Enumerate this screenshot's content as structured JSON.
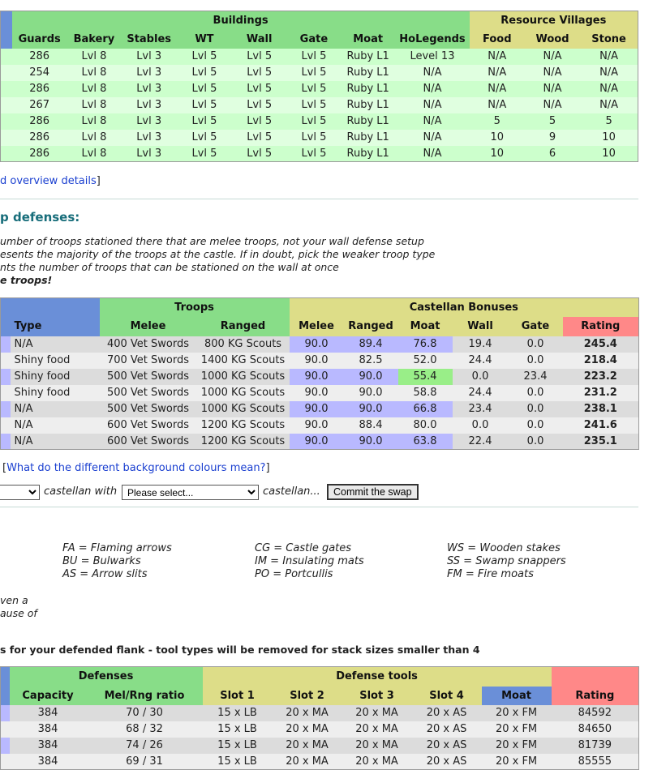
{
  "buildings_table": {
    "group_headers": {
      "buildings": "Buildings",
      "resource_villages": "Resource Villages"
    },
    "columns": [
      "Guards",
      "Bakery",
      "Stables",
      "WT",
      "Wall",
      "Gate",
      "Moat",
      "HoLegends",
      "Food",
      "Wood",
      "Stone"
    ],
    "rows": [
      [
        "286",
        "Lvl 8",
        "Lvl 3",
        "Lvl 5",
        "Lvl 5",
        "Lvl 5",
        "Ruby L1",
        "Level 13",
        "N/A",
        "N/A",
        "N/A"
      ],
      [
        "254",
        "Lvl 8",
        "Lvl 3",
        "Lvl 5",
        "Lvl 5",
        "Lvl 5",
        "Ruby L1",
        "N/A",
        "N/A",
        "N/A",
        "N/A"
      ],
      [
        "286",
        "Lvl 8",
        "Lvl 3",
        "Lvl 5",
        "Lvl 5",
        "Lvl 5",
        "Ruby L1",
        "N/A",
        "N/A",
        "N/A",
        "N/A"
      ],
      [
        "267",
        "Lvl 8",
        "Lvl 3",
        "Lvl 5",
        "Lvl 5",
        "Lvl 5",
        "Ruby L1",
        "N/A",
        "N/A",
        "N/A",
        "N/A"
      ],
      [
        "286",
        "Lvl 8",
        "Lvl 3",
        "Lvl 5",
        "Lvl 5",
        "Lvl 5",
        "Ruby L1",
        "N/A",
        "5",
        "5",
        "5"
      ],
      [
        "286",
        "Lvl 8",
        "Lvl 3",
        "Lvl 5",
        "Lvl 5",
        "Lvl 5",
        "Ruby L1",
        "N/A",
        "10",
        "9",
        "10"
      ],
      [
        "286",
        "Lvl 8",
        "Lvl 3",
        "Lvl 5",
        "Lvl 5",
        "Lvl 5",
        "Ruby L1",
        "N/A",
        "10",
        "6",
        "10"
      ]
    ]
  },
  "overview_link": {
    "text": "d overview details",
    "bracket_close": "]"
  },
  "defenses_section": {
    "heading": "p defenses:",
    "notes": [
      "umber of troops stationed there that are melee troops, not your wall defense setup",
      "esents the majority of the troops at the castle. If in doubt, pick the weaker troop type",
      "nts the number of troops that can be stationed on the wall at once"
    ],
    "notes_bold": "e troops!"
  },
  "troops_table": {
    "group_headers": {
      "troops": "Troops",
      "castellan_bonuses": "Castellan Bonuses"
    },
    "columns": [
      "Type",
      "Melee",
      "Ranged",
      "Melee",
      "Ranged",
      "Moat",
      "Wall",
      "Gate",
      "Rating"
    ],
    "rows": [
      [
        "N/A",
        "400 Vet Swords",
        "800 KG Scouts",
        "90.0",
        "89.4",
        "76.8",
        "19.4",
        "0.0",
        "245.4"
      ],
      [
        "Shiny food",
        "700 Vet Swords",
        "1400 KG Scouts",
        "90.0",
        "82.5",
        "52.0",
        "24.4",
        "0.0",
        "218.4"
      ],
      [
        "Shiny food",
        "500 Vet Swords",
        "1000 KG Scouts",
        "90.0",
        "90.0",
        "55.4",
        "0.0",
        "23.4",
        "223.2"
      ],
      [
        "Shiny food",
        "500 Vet Swords",
        "1000 KG Scouts",
        "90.0",
        "90.0",
        "58.8",
        "24.4",
        "0.0",
        "231.2"
      ],
      [
        "N/A",
        "500 Vet Swords",
        "1000 KG Scouts",
        "90.0",
        "90.0",
        "66.8",
        "23.4",
        "0.0",
        "238.1"
      ],
      [
        "N/A",
        "600 Vet Swords",
        "1200 KG Scouts",
        "90.0",
        "88.4",
        "80.0",
        "0.0",
        "0.0",
        "241.6"
      ],
      [
        "N/A",
        "600 Vet Swords",
        "1200 KG Scouts",
        "90.0",
        "90.0",
        "63.8",
        "22.4",
        "0.0",
        "235.1"
      ]
    ],
    "green_moat_rows": [
      1,
      2,
      3
    ]
  },
  "colours_link": {
    "open": "[",
    "text": "What do the different background colours mean?",
    "close": "]"
  },
  "swap": {
    "label1": "castellan with",
    "select2_value": "Please select...",
    "label2": "castellan...",
    "commit_label": "Commit the swap"
  },
  "legend": {
    "col1": [
      "FA = Flaming arrows",
      "BU = Bulwarks",
      "AS = Arrow slits"
    ],
    "col2": [
      "CG = Castle gates",
      "IM = Insulating mats",
      "PO = Portcullis"
    ],
    "col3": [
      "WS = Wooden stakes",
      "SS = Swamp snappers",
      "FM = Fire moats"
    ],
    "side_note": [
      "ven a",
      "ause of"
    ]
  },
  "flank_heading": "s for your defended flank - tool types will be removed for stack sizes smaller than 4",
  "defense_tools_table": {
    "group_headers": {
      "defenses": "Defenses",
      "defense_tools": "Defense tools"
    },
    "columns": [
      "Capacity",
      "Mel/Rng ratio",
      "Slot 1",
      "Slot 2",
      "Slot 3",
      "Slot 4",
      "Moat",
      "Rating"
    ],
    "rows": [
      [
        "384",
        "70 / 30",
        "15 x LB",
        "20 x MA",
        "20 x MA",
        "20 x AS",
        "20 x FM",
        "84592"
      ],
      [
        "384",
        "68 / 32",
        "15 x LB",
        "20 x MA",
        "20 x MA",
        "20 x AS",
        "20 x FM",
        "84650"
      ],
      [
        "384",
        "74 / 26",
        "15 x LB",
        "20 x MA",
        "20 x MA",
        "20 x AS",
        "20 x FM",
        "81739"
      ],
      [
        "384",
        "69 / 31",
        "15 x LB",
        "20 x MA",
        "20 x MA",
        "20 x AS",
        "20 x FM",
        "85555"
      ]
    ]
  }
}
